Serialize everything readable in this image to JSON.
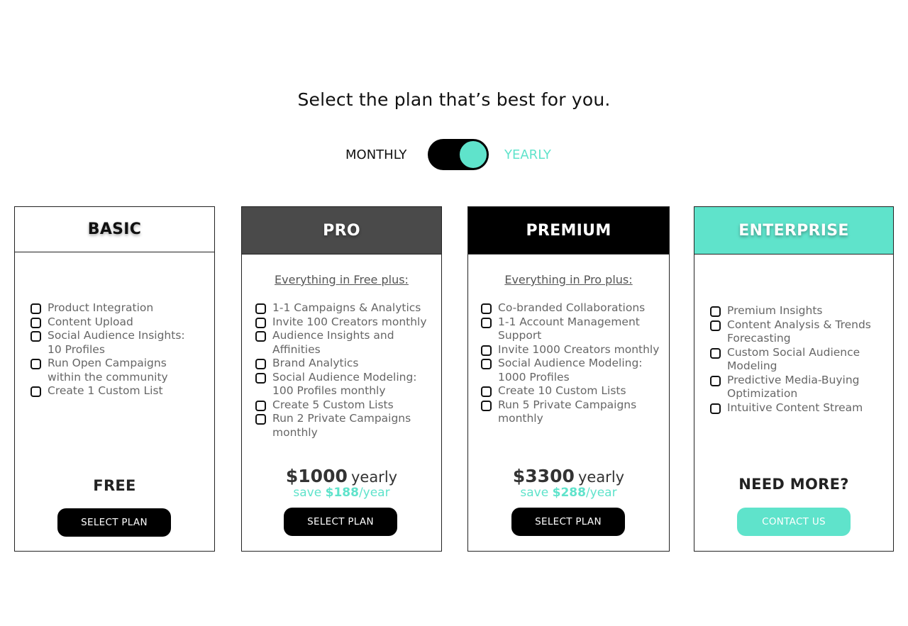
{
  "header": {
    "title": "Select the plan that’s best for you."
  },
  "billing": {
    "monthly_label": "MONTHLY",
    "yearly_label": "YEARLY",
    "selected": "yearly"
  },
  "colors": {
    "accent": "#5fe3cb",
    "pro_header": "#4a4a4a",
    "premium_header": "#000000"
  },
  "plans": {
    "basic": {
      "name": "BASIC",
      "features": [
        "Product Integration",
        "Content Upload",
        "Social Audience Insights: 10 Profiles",
        "Run Open Campaigns within the community",
        "Create 1 Custom List"
      ],
      "price_label": "FREE",
      "button_label": "SELECT PLAN"
    },
    "pro": {
      "name": "PRO",
      "intro": "Everything in Free plus:",
      "features": [
        "1-1 Campaigns & Analytics",
        "Invite 100 Creators monthly",
        "Audience Insights and Affinities",
        "Brand Analytics",
        "Social Audience Modeling: 100 Profiles monthly",
        "Create 5 Custom Lists",
        "Run 2 Private Campaigns monthly"
      ],
      "price_amount": "$1000",
      "price_period": "yearly",
      "save_prefix": "save",
      "save_amount": "$188",
      "save_suffix": "/year",
      "button_label": "SELECT PLAN"
    },
    "premium": {
      "name": "PREMIUM",
      "intro": "Everything in Pro plus:",
      "features": [
        "Co-branded Collaborations",
        "1-1 Account Management Support",
        "Invite 1000 Creators monthly",
        "Social Audience Modeling: 1000 Profiles",
        "Create 10 Custom Lists",
        "Run 5 Private Campaigns monthly"
      ],
      "price_amount": "$3300",
      "price_period": "yearly",
      "save_prefix": "save",
      "save_amount": "$288",
      "save_suffix": "/year",
      "button_label": "SELECT PLAN"
    },
    "enterprise": {
      "name": "ENTERPRISE",
      "features": [
        "Premium Insights",
        "Content Analysis & Trends Forecasting",
        "Custom Social Audience Modeling",
        "Predictive Media-Buying Optimization",
        "Intuitive Content Stream"
      ],
      "price_label": "NEED MORE?",
      "button_label": "CONTACT US"
    }
  }
}
